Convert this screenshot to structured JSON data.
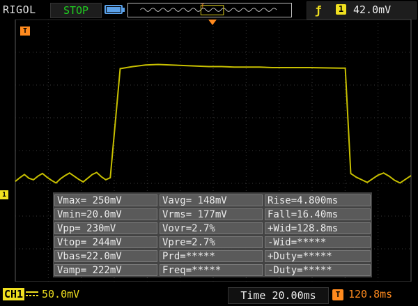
{
  "header": {
    "brand": "RIGOL",
    "run_status": "STOP",
    "trigger_level": "42.0mV",
    "trigger_channel": "1",
    "trigger_edge_icon": "rising-edge-icon"
  },
  "markers": {
    "trigger_level_marker": "T",
    "channel_marker": "1",
    "trigger_pos_marker": "T"
  },
  "measurements": [
    [
      "Vmax= 250mV",
      "Vavg= 148mV",
      "Rise=4.800ms"
    ],
    [
      "Vmin=20.0mV",
      "Vrms= 177mV",
      "Fall=16.40ms"
    ],
    [
      "Vpp= 230mV",
      "Vovr=2.7%",
      "+Wid=128.8ms"
    ],
    [
      "Vtop= 244mV",
      "Vpre=2.7%",
      "-Wid=*****"
    ],
    [
      "Vbas=22.0mV",
      "Prd=*****",
      "+Duty=*****"
    ],
    [
      "Vamp= 222mV",
      "Freq=*****",
      "-Duty=*****"
    ]
  ],
  "footer": {
    "channel_label": "CH1",
    "channel_scale": "50.0mV",
    "timebase": "Time 20.00ms",
    "horizontal_position": "120.8ms",
    "horizontal_icon": "T"
  },
  "colors": {
    "trace": "#c8c000",
    "trigger": "#ff8a1e",
    "channel": "#f0e020",
    "run_status": "#1fd11f"
  },
  "chart_data": {
    "type": "line",
    "series": [
      {
        "values_mV": [
          25,
          32,
          38,
          31,
          28,
          35,
          40,
          33,
          27,
          22,
          30,
          36,
          41,
          35,
          29,
          24,
          31,
          38,
          42,
          34,
          28,
          32,
          240,
          244,
          247,
          248,
          247,
          246,
          245,
          244,
          244,
          243,
          243,
          243,
          242,
          242,
          242,
          242,
          241,
          241,
          40,
          33,
          28,
          23,
          30,
          37,
          41,
          35,
          27,
          22,
          29,
          36
        ]
      }
    ],
    "vertical_scale": "50.0mV/div",
    "time_scale": "20.00ms/div"
  }
}
